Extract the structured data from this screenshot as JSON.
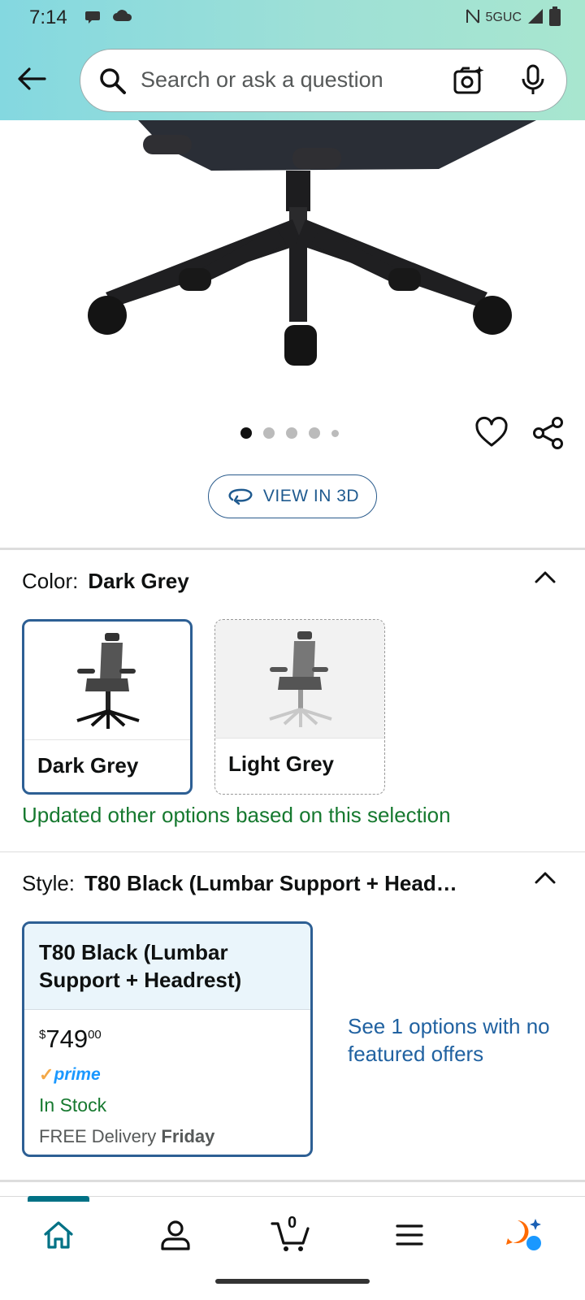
{
  "status_bar": {
    "time": "7:14",
    "network": "5GUC"
  },
  "search": {
    "placeholder": "Search or ask a question"
  },
  "carousel": {
    "dot_count": 5,
    "active_index": 0
  },
  "view_3d": {
    "label": "VIEW IN 3D"
  },
  "color_section": {
    "label": "Color:",
    "selected_value": "Dark Grey",
    "options": [
      {
        "label": "Dark Grey",
        "selected": true
      },
      {
        "label": "Light Grey",
        "selected": false
      }
    ],
    "note": "Updated other options based on this selection"
  },
  "style_section": {
    "label": "Style:",
    "selected_value": "T80 Black (Lumbar Support + Head…",
    "card": {
      "title": "T80 Black (Lumbar Support + Headrest)",
      "price_symbol": "$",
      "price_whole": "749",
      "price_fraction": "00",
      "prime_label": "prime",
      "stock": "In Stock",
      "delivery_prefix": "FREE Delivery",
      "delivery_day": "Friday"
    },
    "see_more": "See 1 options with no featured offers"
  },
  "bottom_nav": {
    "cart_count": "0",
    "items": [
      "home-icon",
      "account-icon",
      "cart-icon",
      "menu-icon",
      "rufus-icon"
    ]
  },
  "colors": {
    "accent_teal": "#007185",
    "link_blue": "#2162a1",
    "selected_border": "#2d5f94",
    "success_green": "#16792f",
    "prime_blue": "#1a98ff"
  }
}
